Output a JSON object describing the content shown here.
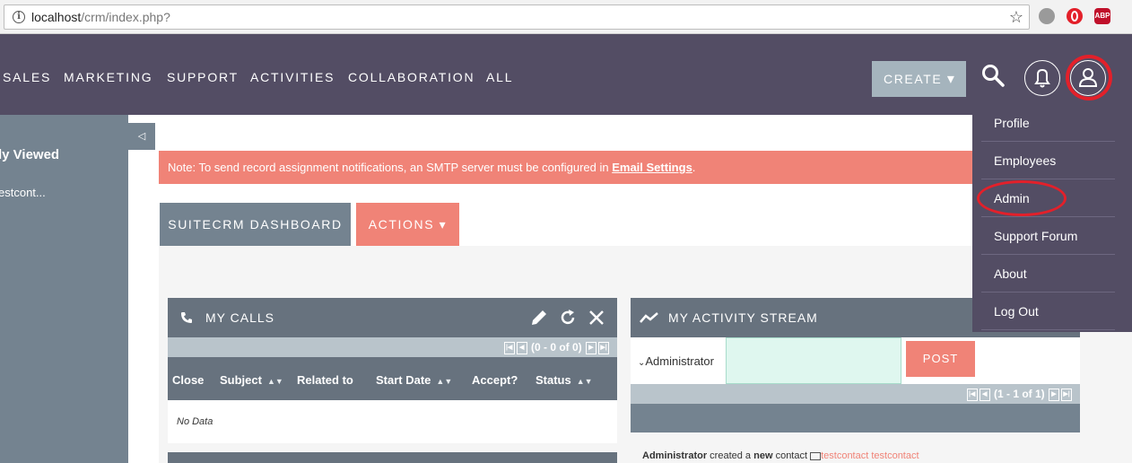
{
  "browser": {
    "url_host": "localhost",
    "url_path": "/crm/index.php?",
    "extensions": [
      {
        "name": "extension-icon-gray",
        "label": ""
      },
      {
        "name": "opera-icon",
        "label": ""
      },
      {
        "name": "adblock-plus-icon",
        "label": "ABP"
      }
    ]
  },
  "topnav": {
    "items": [
      "SALES",
      "MARKETING",
      "SUPPORT",
      "ACTIVITIES",
      "COLLABORATION",
      "ALL"
    ],
    "create_label": "CREATE",
    "create_caret": "▾"
  },
  "sidebar": {
    "title": "ly Viewed",
    "item": "estcont...",
    "collapse_glyph": "◁"
  },
  "notice": {
    "text": "Note: To send record assignment notifications, an SMTP server must be configured in ",
    "link": "Email Settings",
    "end": "."
  },
  "tabs": {
    "dashboard": "SUITECRM DASHBOARD",
    "actions": "ACTIONS ▾"
  },
  "my_calls": {
    "title": "MY CALLS",
    "pager_text": "(0 - 0 of 0)",
    "columns": [
      "Close",
      "Subject",
      "Related to",
      "Start Date",
      "Accept?",
      "Status"
    ],
    "no_data": "No Data"
  },
  "activity_stream": {
    "title": "MY ACTIVITY STREAM",
    "user": "Administrator",
    "post_label": "POST",
    "pager_text": "(1 - 1 of 1)",
    "entry_user": "Administrator",
    "entry_mid": " created a ",
    "entry_new": "new",
    "entry_after": " contact ",
    "entry_link": "testcontact testcontact"
  },
  "user_menu": {
    "items": [
      "Profile",
      "Employees",
      "Admin",
      "Support Forum",
      "About",
      "Log Out"
    ]
  },
  "colors": {
    "nav_bg": "#534d64",
    "sidebar_bg": "#748390",
    "accent": "#f08377",
    "dashlet_head": "#67727e",
    "highlight": "#e3202a"
  }
}
